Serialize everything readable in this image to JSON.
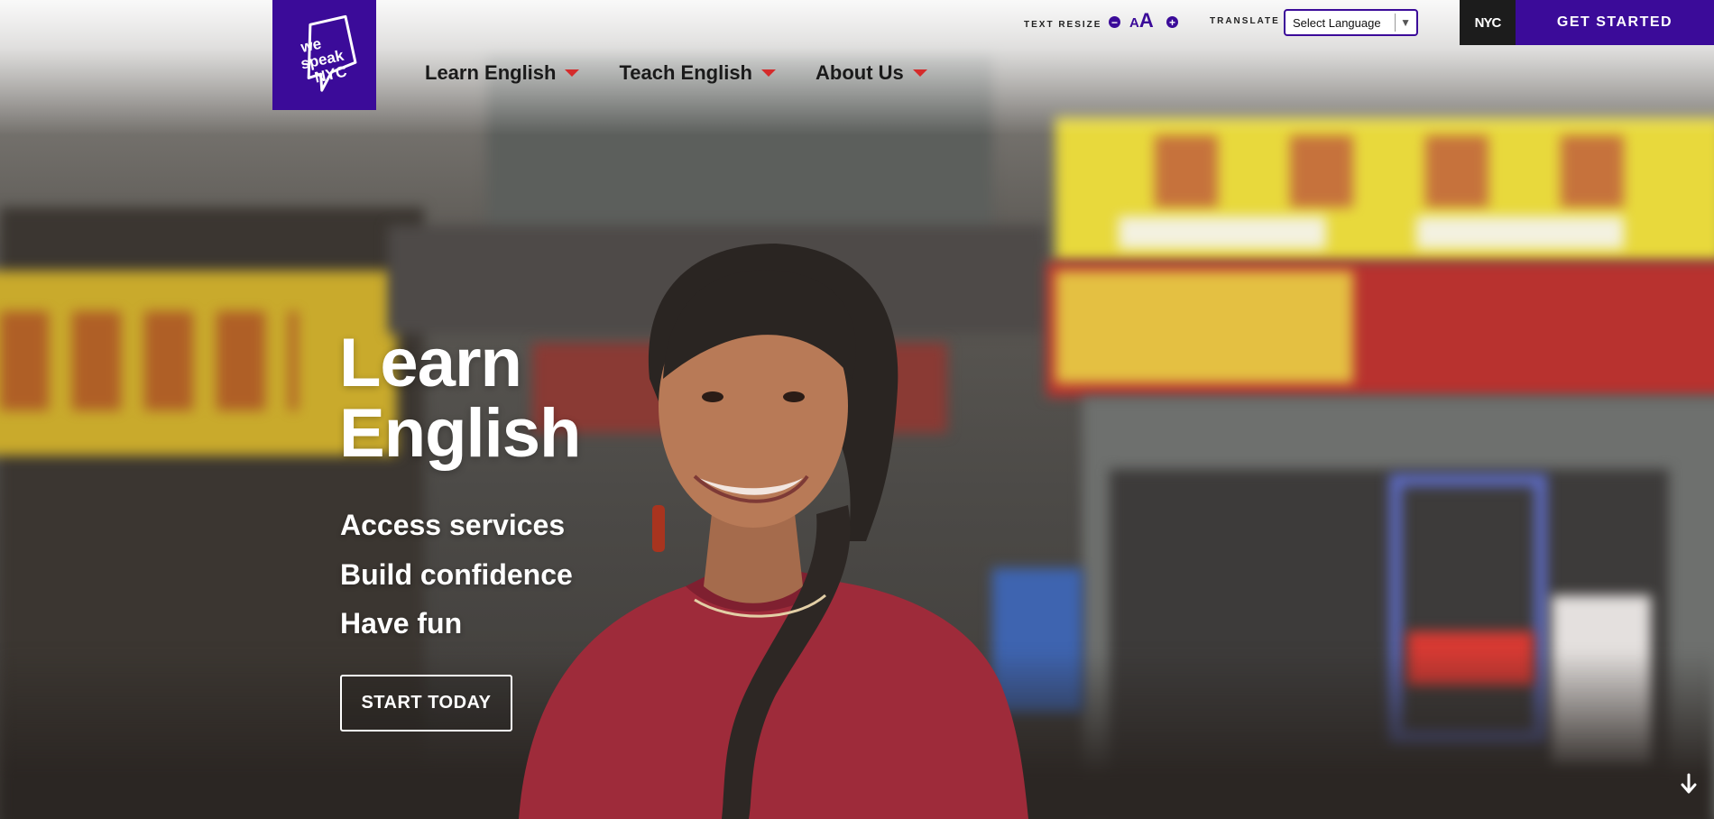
{
  "header": {
    "logo_text": [
      "we",
      "speak",
      "NYC"
    ],
    "utility": {
      "text_resize_label": "TEXT RESIZE",
      "text_resize_small": "A",
      "text_resize_large": "A",
      "translate_label": "TRANSLATE",
      "language_select_value": "Select Language"
    },
    "nyc_badge": "NYC",
    "get_started_label": "GET STARTED"
  },
  "nav": {
    "items": [
      {
        "label": "Learn English"
      },
      {
        "label": "Teach English"
      },
      {
        "label": "About Us"
      }
    ]
  },
  "hero": {
    "title_line1": "Learn",
    "title_line2": "English",
    "bullets": [
      "Access services",
      "Build confidence",
      "Have fun"
    ],
    "cta_label": "START TODAY"
  },
  "colors": {
    "brand_purple": "#3b0b99",
    "nav_caret_red": "#d52b2b",
    "nyc_black": "#1c1c1c"
  },
  "icons": [
    "logo-speech-bubble",
    "minus-circle-icon",
    "plus-circle-icon",
    "dropdown-caret-icon",
    "scroll-down-arrow-icon"
  ]
}
